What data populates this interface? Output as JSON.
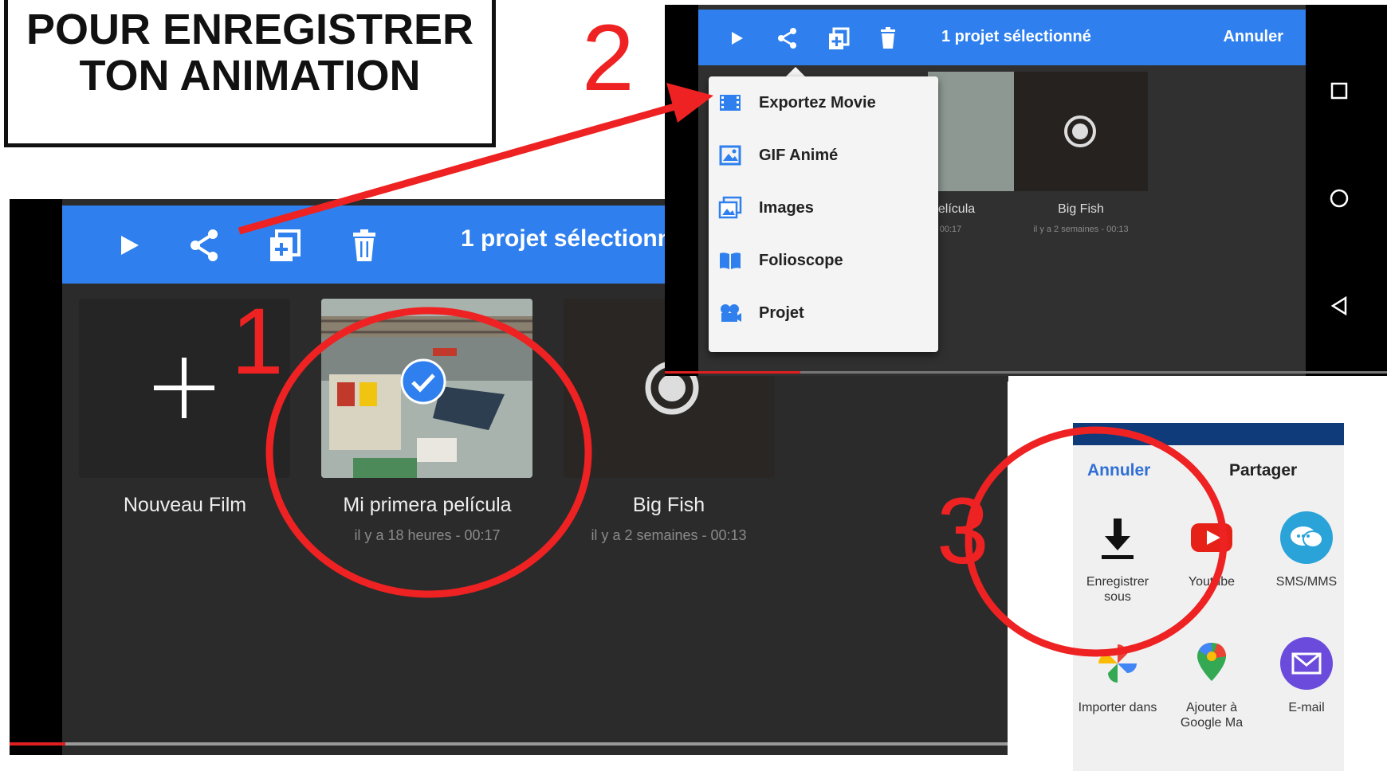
{
  "header": {
    "title_line1": "POUR ENREGISTRER",
    "title_line2": "TON ANIMATION"
  },
  "steps": [
    "1",
    "2",
    "3"
  ],
  "colors": {
    "accent_blue": "#2f80ee",
    "annotation_red": "#ee2222",
    "dark_bg": "#2b2b2b"
  },
  "screen1": {
    "toolbar": {
      "icons": [
        "play-icon",
        "share-icon",
        "duplicate-icon",
        "trash-icon"
      ],
      "selection_label": "1 projet sélectionné"
    },
    "projects": [
      {
        "name": "Nouveau Film",
        "meta": "",
        "icon": "plus-icon"
      },
      {
        "name": "Mi primera película",
        "meta": "il y a 18 heures - 00:17",
        "selected": true,
        "icon": "check-icon"
      },
      {
        "name": "Big Fish",
        "meta": "il y a 2 semaines - 00:13",
        "icon": "record-icon"
      }
    ]
  },
  "screen2": {
    "toolbar": {
      "selection_label": "1 projet sélectionné",
      "cancel_label": "Annuler"
    },
    "menu": [
      {
        "label": "Exportez Movie",
        "icon": "film-icon"
      },
      {
        "label": "GIF Animé",
        "icon": "image-icon"
      },
      {
        "label": "Images",
        "icon": "images-icon"
      },
      {
        "label": "Folioscope",
        "icon": "book-icon"
      },
      {
        "label": "Projet",
        "icon": "projector-icon"
      }
    ],
    "thumbs": [
      {
        "name": "película",
        "meta": "- 00:17"
      },
      {
        "name": "Big Fish",
        "meta": "il y a 2 semaines - 00:13"
      }
    ],
    "system_nav": [
      "square-icon",
      "circle-icon",
      "back-triangle-icon"
    ]
  },
  "screen3": {
    "cancel_label": "Annuler",
    "title": "Partager",
    "apps": [
      {
        "label": "Enregistrer sous",
        "icon": "download-icon"
      },
      {
        "label": "Youtube",
        "icon": "youtube-icon"
      },
      {
        "label": "SMS/MMS",
        "icon": "sms-icon"
      },
      {
        "label": "Importer dans",
        "icon": "photos-pinwheel-icon"
      },
      {
        "label": "Ajouter à Google Ma",
        "icon": "maps-pin-icon"
      },
      {
        "label": "E-mail",
        "icon": "mail-icon"
      }
    ]
  }
}
